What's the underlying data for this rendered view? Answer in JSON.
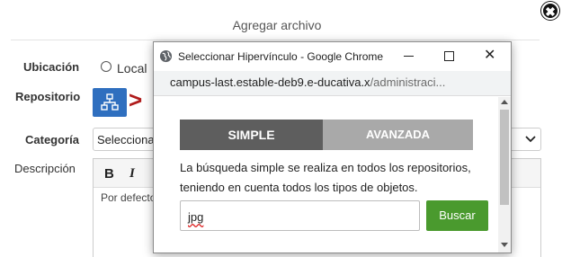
{
  "background_dialog": {
    "title": "Agregar archivo",
    "close_symbol": "✖",
    "fields": {
      "ubicacion_label": "Ubicación",
      "ubicacion_option": "Local",
      "repositorio_label": "Repositorio",
      "repositorio_icon": "sitemap-icon",
      "repositorio_arrow": ">",
      "categoria_label": "Categoría",
      "categoria_value": "Seleccionar",
      "descripcion_label": "Descripción",
      "editor_bold": "B",
      "editor_italic": "I",
      "editor_text": "Por defecto"
    }
  },
  "popup": {
    "window_title": "Seleccionar Hipervínculo - Google Chrome",
    "url_host": "campus-last.estable-deb9.e-ducativa.x",
    "url_path": "/administraci...",
    "tabs": [
      {
        "label": "SIMPLE",
        "active": true
      },
      {
        "label": "AVANZADA",
        "active": false
      }
    ],
    "description": "La búsqueda simple se realiza en todos los repositorios, teniendo en cuenta todos los tipos de objetos.",
    "search_value": "jpg",
    "search_button": "Buscar"
  },
  "colors": {
    "repo_button": "#2f6fbf",
    "arrow_red": "#b01c1c",
    "tab_active": "#5e5e5e",
    "tab_inactive": "#a9a9a9",
    "search_button": "#4a9a2e"
  }
}
